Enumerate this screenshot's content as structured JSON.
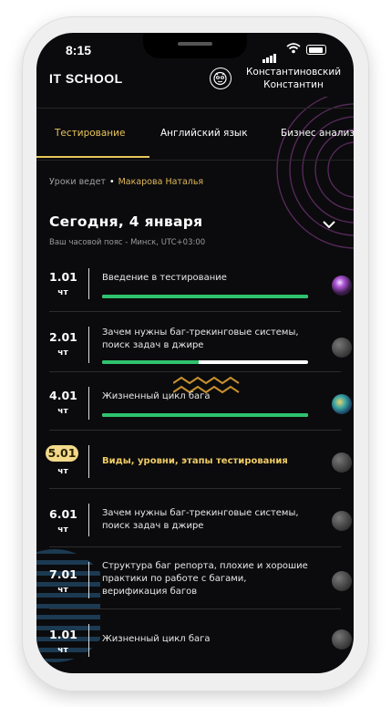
{
  "status": {
    "time": "8:15"
  },
  "header": {
    "logo": "IT SCHOOL",
    "username": "Константиновский Константин"
  },
  "tabs": [
    {
      "label": "Тестирование",
      "active": true
    },
    {
      "label": "Английский язык",
      "active": false
    },
    {
      "label": "Бизнес анализ",
      "active": false
    }
  ],
  "teacher": {
    "prefix": "Уроки ведет",
    "bullet": "•",
    "name": "Макарова Наталья"
  },
  "day": {
    "title": "Сегодня, 4 января",
    "timezone": "Ваш часовой пояс - Минск, UTC+03:00"
  },
  "lessons": [
    {
      "date": "1.01",
      "dow": "чт",
      "title": "Введение в тестирование",
      "progress": 1.0,
      "icon": "planet-purple-icon"
    },
    {
      "date": "2.01",
      "dow": "чт",
      "title": "Зачем нужны баг-трекинговые системы, поиск задач в джире",
      "progress": 0.47,
      "icon": "planet-grey-icon"
    },
    {
      "date": "4.01",
      "dow": "чт",
      "title": "Жизненный цикл бага",
      "progress": 1.0,
      "icon": "planet-teal-icon"
    },
    {
      "date": "5.01",
      "dow": "чт",
      "title": "Виды, уровни, этапы тестирования",
      "current": true,
      "icon": "planet-grey-icon"
    },
    {
      "date": "6.01",
      "dow": "чт",
      "title": "Зачем нужны баг-трекинговые системы, поиск задач в джире",
      "icon": "planet-grey-icon"
    },
    {
      "date": "7.01",
      "dow": "чт",
      "title": "Структура баг репорта, плохие и хорошие практики по работе с багами, верификация багов",
      "icon": "planet-grey-icon"
    },
    {
      "date": "1.01",
      "dow": "чт",
      "title": "Жизненный цикл бага",
      "icon": "planet-grey-icon"
    }
  ],
  "colors": {
    "accent": "#e8c55a",
    "progress": "#2fc26e",
    "background": "#0b0b0d"
  }
}
